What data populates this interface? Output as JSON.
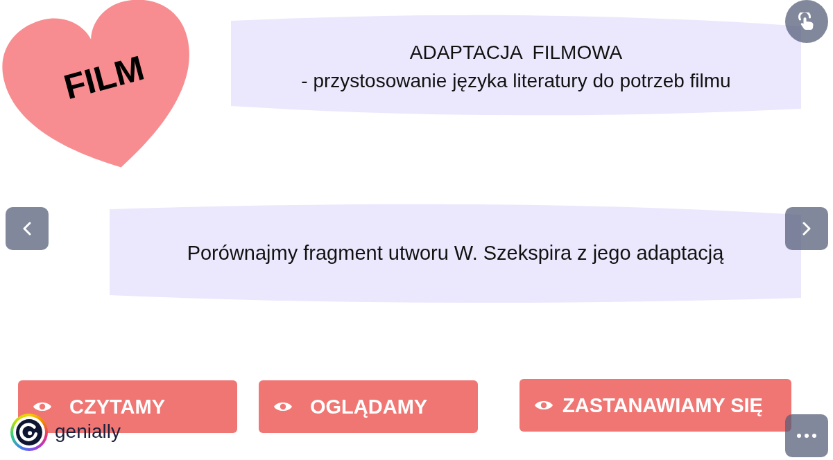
{
  "slide": {
    "heart": {
      "label": "FILM"
    },
    "title_banner": {
      "lines": [
        "ADAPTACJA  FILMOWA",
        "- przystosowanie języka literatury do potrzeb filmu"
      ]
    },
    "text_banner": {
      "text": "Porównajmy fragment utworu W. Szekspira z jego adaptacją"
    },
    "buttons": [
      {
        "label": "CZYTAMY"
      },
      {
        "label": "OGLĄDAMY"
      },
      {
        "label": "ZASTANAWIAMY SIĘ"
      }
    ]
  },
  "branding": {
    "logo_text": "genially"
  }
}
